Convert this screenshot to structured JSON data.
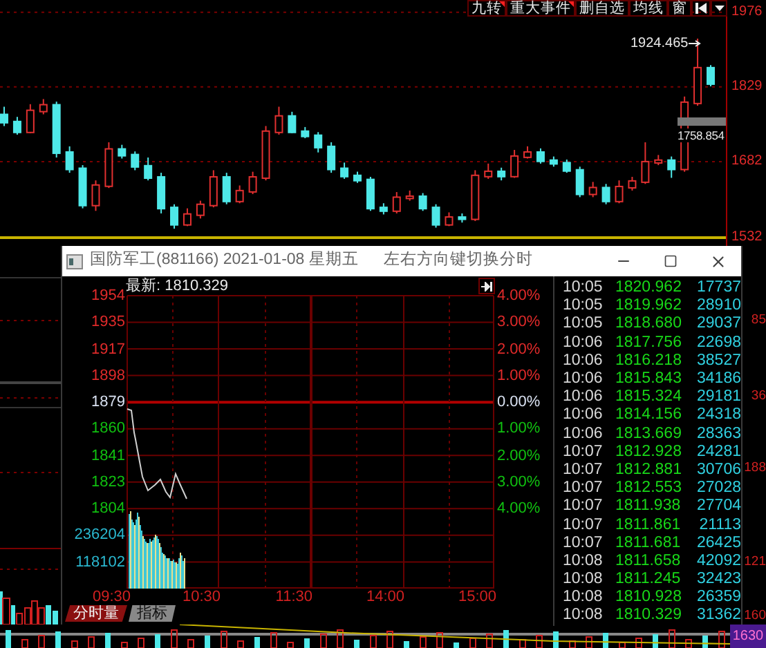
{
  "toolbar": [
    {
      "label": "九转",
      "marked": true
    },
    {
      "label": "重大事件",
      "marked": true
    },
    {
      "label": "删自选",
      "marked": false
    },
    {
      "label": "均线",
      "marked": false
    },
    {
      "label": "窗",
      "marked": false
    }
  ],
  "chart_data": {
    "type": "candlestick",
    "grid": true,
    "ylim": [
      1516,
      2000
    ],
    "yticks": [
      1976,
      1829,
      1682,
      1532
    ],
    "ohlc": [
      [
        1775,
        1790,
        1752,
        1761
      ],
      [
        1761,
        1770,
        1735,
        1742
      ],
      [
        1742,
        1795,
        1738,
        1783
      ],
      [
        1783,
        1805,
        1775,
        1794
      ],
      [
        1794,
        1800,
        1690,
        1701
      ],
      [
        1701,
        1712,
        1660,
        1669
      ],
      [
        1669,
        1675,
        1590,
        1598
      ],
      [
        1598,
        1645,
        1585,
        1636
      ],
      [
        1636,
        1720,
        1630,
        1707
      ],
      [
        1707,
        1715,
        1688,
        1696
      ],
      [
        1696,
        1702,
        1665,
        1674
      ],
      [
        1674,
        1690,
        1645,
        1652
      ],
      [
        1652,
        1660,
        1580,
        1592
      ],
      [
        1592,
        1598,
        1550,
        1560
      ],
      [
        1560,
        1590,
        1555,
        1579
      ],
      [
        1579,
        1605,
        1570,
        1598
      ],
      [
        1598,
        1665,
        1592,
        1652
      ],
      [
        1652,
        1660,
        1598,
        1606
      ],
      [
        1606,
        1635,
        1600,
        1625
      ],
      [
        1625,
        1662,
        1618,
        1652
      ],
      [
        1652,
        1752,
        1645,
        1742
      ],
      [
        1742,
        1790,
        1735,
        1772
      ],
      [
        1772,
        1780,
        1738,
        1742
      ],
      [
        1742,
        1750,
        1728,
        1734
      ],
      [
        1734,
        1740,
        1700,
        1712
      ],
      [
        1712,
        1720,
        1660,
        1669
      ],
      [
        1669,
        1680,
        1648,
        1655
      ],
      [
        1655,
        1662,
        1640,
        1647
      ],
      [
        1647,
        1652,
        1585,
        1592
      ],
      [
        1592,
        1600,
        1578,
        1587
      ],
      [
        1587,
        1622,
        1580,
        1612
      ],
      [
        1612,
        1625,
        1605,
        1614
      ],
      [
        1614,
        1620,
        1585,
        1592
      ],
      [
        1592,
        1598,
        1552,
        1560
      ],
      [
        1560,
        1582,
        1555,
        1573
      ],
      [
        1573,
        1580,
        1562,
        1571
      ],
      [
        1571,
        1665,
        1565,
        1655
      ],
      [
        1655,
        1678,
        1648,
        1663
      ],
      [
        1663,
        1670,
        1645,
        1655
      ],
      [
        1655,
        1705,
        1650,
        1693
      ],
      [
        1693,
        1712,
        1688,
        1701
      ],
      [
        1701,
        1708,
        1678,
        1685
      ],
      [
        1685,
        1692,
        1672,
        1680
      ],
      [
        1680,
        1686,
        1660,
        1666
      ],
      [
        1666,
        1672,
        1612,
        1620
      ],
      [
        1620,
        1642,
        1612,
        1631
      ],
      [
        1631,
        1638,
        1598,
        1606
      ],
      [
        1606,
        1645,
        1600,
        1633
      ],
      [
        1633,
        1652,
        1625,
        1644
      ],
      [
        1644,
        1720,
        1638,
        1682
      ],
      [
        1682,
        1695,
        1675,
        1685
      ],
      [
        1685,
        1692,
        1650,
        1669
      ],
      [
        1669,
        1810,
        1662,
        1799
      ],
      [
        1799,
        1924,
        1792,
        1867
      ],
      [
        1867,
        1872,
        1830,
        1837
      ]
    ]
  },
  "high_marker": "1924.465",
  "low_marker": "1758.854",
  "popup": {
    "title": "国防军工(881166) 2021-01-08 星期五",
    "hint": "左右方向键切换分时",
    "latest": "最新: 1810.329",
    "price_labels": [
      {
        "text": "1954",
        "color": "#e02a2a"
      },
      {
        "text": "1935",
        "color": "#e02a2a"
      },
      {
        "text": "1917",
        "color": "#e02a2a"
      },
      {
        "text": "1898",
        "color": "#e02a2a"
      },
      {
        "text": "1879",
        "color": "#d8e0f0"
      },
      {
        "text": "1860",
        "color": "#10c010"
      },
      {
        "text": "1841",
        "color": "#10c010"
      },
      {
        "text": "1823",
        "color": "#10c010"
      },
      {
        "text": "1804",
        "color": "#10c010"
      },
      {
        "text": "236204",
        "color": "#2ab8d0"
      },
      {
        "text": "118102",
        "color": "#2ab8d0"
      }
    ],
    "percent_labels": [
      {
        "text": "4.00%",
        "color": "#e02a2a"
      },
      {
        "text": "3.00%",
        "color": "#e02a2a"
      },
      {
        "text": "2.00%",
        "color": "#e02a2a"
      },
      {
        "text": "1.00%",
        "color": "#e02a2a"
      },
      {
        "text": "0.00%",
        "color": "#d8e0f0"
      },
      {
        "text": "1.00%",
        "color": "#10c010"
      },
      {
        "text": "2.00%",
        "color": "#10c010"
      },
      {
        "text": "3.00%",
        "color": "#10c010"
      },
      {
        "text": "4.00%",
        "color": "#10c010"
      }
    ],
    "time_labels": [
      "09:30",
      "10:30",
      "11:30",
      "14:00",
      "15:00"
    ],
    "tabs": [
      {
        "label": "分时量",
        "selected": true
      },
      {
        "label": "指标",
        "selected": false
      }
    ],
    "ticks": [
      {
        "time": "10:05",
        "price": "1820.962",
        "volume": "17737"
      },
      {
        "time": "10:05",
        "price": "1819.962",
        "volume": "28910"
      },
      {
        "time": "10:05",
        "price": "1818.680",
        "volume": "29037"
      },
      {
        "time": "10:06",
        "price": "1817.756",
        "volume": "22698"
      },
      {
        "time": "10:06",
        "price": "1816.218",
        "volume": "38527"
      },
      {
        "time": "10:06",
        "price": "1815.843",
        "volume": "34186"
      },
      {
        "time": "10:06",
        "price": "1815.324",
        "volume": "29181"
      },
      {
        "time": "10:06",
        "price": "1814.156",
        "volume": "24318"
      },
      {
        "time": "10:06",
        "price": "1813.669",
        "volume": "28363"
      },
      {
        "time": "10:07",
        "price": "1812.928",
        "volume": "24281"
      },
      {
        "time": "10:07",
        "price": "1812.881",
        "volume": "30706"
      },
      {
        "time": "10:07",
        "price": "1812.553",
        "volume": "27028"
      },
      {
        "time": "10:07",
        "price": "1811.938",
        "volume": "27704"
      },
      {
        "time": "10:07",
        "price": "1811.861",
        "volume": "21113"
      },
      {
        "time": "10:07",
        "price": "1811.681",
        "volume": "26425"
      },
      {
        "time": "10:08",
        "price": "1811.658",
        "volume": "42092"
      },
      {
        "time": "10:08",
        "price": "1811.245",
        "volume": "32423"
      },
      {
        "time": "10:08",
        "price": "1810.928",
        "volume": "26359"
      },
      {
        "time": "10:08",
        "price": "1810.329",
        "volume": "31362"
      }
    ]
  },
  "side_axis_fragments": [
    "85",
    "36",
    "188",
    "121",
    "160"
  ],
  "volume_axis_label": "1630"
}
